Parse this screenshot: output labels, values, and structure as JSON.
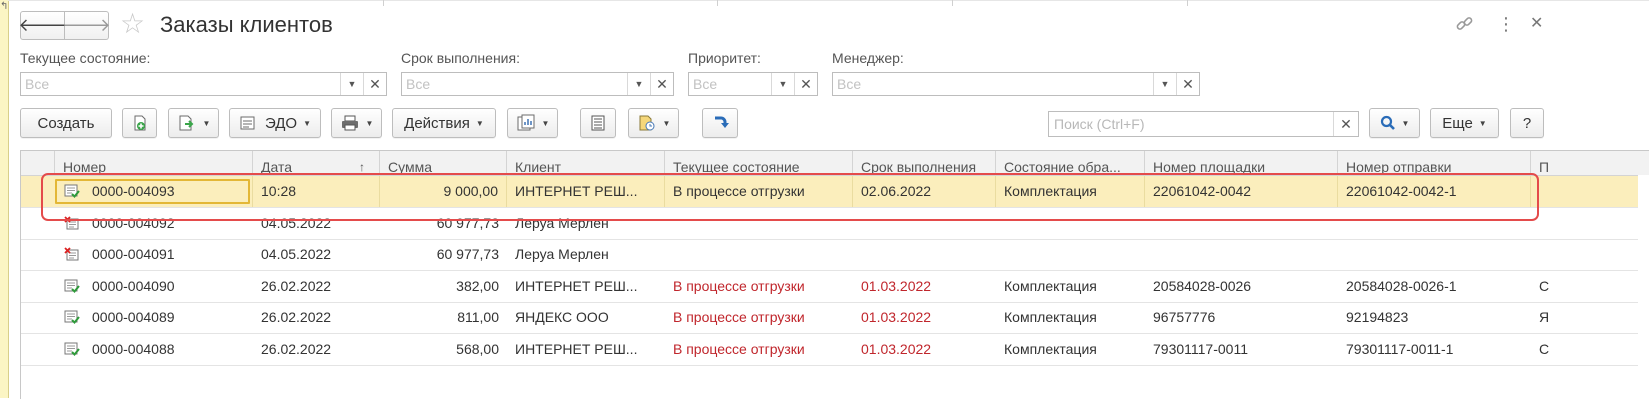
{
  "window": {
    "title": "Заказы клиентов",
    "back_icon": "arrow-left-icon",
    "forward_icon": "arrow-right-icon",
    "favorite_icon": "star-icon",
    "link_icon": "link-icon",
    "more_icon": "vertical-dots-icon",
    "close_icon": "close-icon"
  },
  "filters": [
    {
      "label": "Текущее состояние:",
      "placeholder": "Все"
    },
    {
      "label": "Срок выполнения:",
      "placeholder": "Все"
    },
    {
      "label": "Приоритет:",
      "placeholder": "Все"
    },
    {
      "label": "Менеджер:",
      "placeholder": "Все"
    }
  ],
  "toolbar": {
    "create_label": "Создать",
    "edo_label": "ЭДО",
    "actions_label": "Действия",
    "search_placeholder": "Поиск (Ctrl+F)",
    "more_label": "Еще",
    "help_label": "?"
  },
  "table": {
    "columns": [
      "Номер",
      "Дата",
      "Сумма",
      "Клиент",
      "Текущее состояние",
      "Срок выполнения",
      "Состояние обра...",
      "Номер площадки",
      "Номер отправки",
      "П"
    ],
    "sorted_column": "Дата",
    "rows": [
      {
        "icon": "order-posted-icon",
        "number": "0000-004093",
        "date": "10:28",
        "sum": "9 000,00",
        "client": "ИНТЕРНЕТ РЕШ...",
        "state": "В процессе отгрузки",
        "deadline": "02.06.2022",
        "processing": "Комплектация",
        "site_no": "22061042-0042",
        "ship_no": "22061042-0042-1",
        "extra": "",
        "selected": true,
        "red": false
      },
      {
        "icon": "order-deleted-icon",
        "number": "0000-004092",
        "date": "04.05.2022",
        "sum": "60 977,73",
        "client": "Леруа Мерлен",
        "state": "",
        "deadline": "",
        "processing": "",
        "site_no": "",
        "ship_no": "",
        "extra": "",
        "selected": false,
        "red": false
      },
      {
        "icon": "order-deleted-icon",
        "number": "0000-004091",
        "date": "04.05.2022",
        "sum": "60 977,73",
        "client": "Леруа Мерлен",
        "state": "",
        "deadline": "",
        "processing": "",
        "site_no": "",
        "ship_no": "",
        "extra": "",
        "selected": false,
        "red": false
      },
      {
        "icon": "order-posted-icon",
        "number": "0000-004090",
        "date": "26.02.2022",
        "sum": "382,00",
        "client": "ИНТЕРНЕТ РЕШ...",
        "state": "В процессе отгрузки",
        "deadline": "01.03.2022",
        "processing": "Комплектация",
        "site_no": "20584028-0026",
        "ship_no": "20584028-0026-1",
        "extra": "С",
        "selected": false,
        "red": true
      },
      {
        "icon": "order-posted-icon",
        "number": "0000-004089",
        "date": "26.02.2022",
        "sum": "811,00",
        "client": "ЯНДЕКС ООО",
        "state": "В процессе отгрузки",
        "deadline": "01.03.2022",
        "processing": "Комплектация",
        "site_no": "96757776",
        "ship_no": "92194823",
        "extra": "Я",
        "selected": false,
        "red": true
      },
      {
        "icon": "order-posted-icon",
        "number": "0000-004088",
        "date": "26.02.2022",
        "sum": "568,00",
        "client": "ИНТЕРНЕТ РЕШ...",
        "state": "В процессе отгрузки",
        "deadline": "01.03.2022",
        "processing": "Комплектация",
        "site_no": "79301117-0011",
        "ship_no": "79301117-0011-1",
        "extra": "С",
        "selected": false,
        "red": true
      }
    ]
  },
  "colors": {
    "selected_row": "#fbeebc",
    "focus_border": "#e3b736",
    "highlight_ring": "#e44b4b",
    "overdue_text": "#c0262c"
  }
}
